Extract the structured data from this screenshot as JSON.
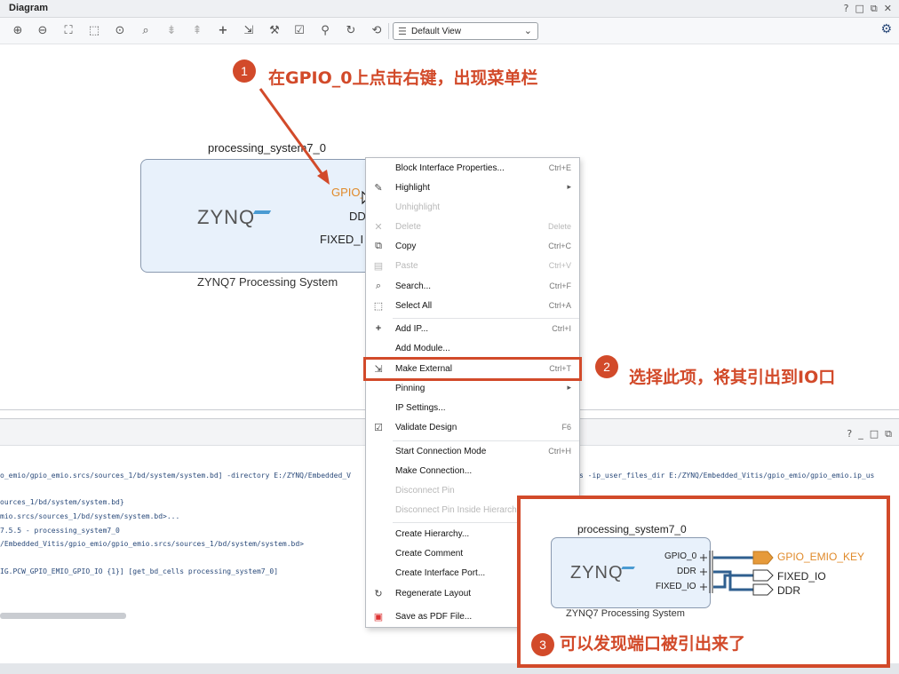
{
  "diagram": {
    "title": "Diagram",
    "window_controls": [
      "?",
      "□",
      "⧉",
      "✕"
    ],
    "view_select": "Default View",
    "toolbar_icons": [
      "zoom-in-icon",
      "zoom-out-icon",
      "zoom-fit-icon",
      "zoom-area-icon",
      "crosshair-icon",
      "search-icon",
      "collapse-icon",
      "expand-icon",
      "add-icon",
      "make-external-icon",
      "wrench-icon",
      "validate-icon",
      "pin-icon",
      "refresh-icon",
      "regenerate-icon"
    ]
  },
  "block": {
    "instance_name": "processing_system7_0",
    "logo": "ZYNQ",
    "caption": "ZYNQ7 Processing System",
    "ports": {
      "gpio": "GPIO_",
      "ddr": "DD",
      "fixed": "FIXED_I"
    }
  },
  "annotations": {
    "step1_num": "1",
    "step1_text": "在GPIO_0上点击右键，出现菜单栏",
    "step2_num": "2",
    "step2_text": "选择此项，将其引出到IO口",
    "step3_num": "3",
    "step3_text": "可以发现端口被引出来了"
  },
  "context_menu": {
    "items": [
      {
        "label": "Block Interface Properties...",
        "shortcut": "Ctrl+E",
        "icon": "",
        "disabled": false
      },
      {
        "label": "Highlight",
        "shortcut": "",
        "icon": "highlight-icon",
        "submenu": true,
        "disabled": false
      },
      {
        "label": "Unhighlight",
        "shortcut": "",
        "icon": "",
        "disabled": true
      },
      {
        "label": "Delete",
        "shortcut": "Delete",
        "icon": "delete-icon",
        "disabled": true
      },
      {
        "label": "Copy",
        "shortcut": "Ctrl+C",
        "icon": "copy-icon",
        "disabled": false
      },
      {
        "label": "Paste",
        "shortcut": "Ctrl+V",
        "icon": "paste-icon",
        "disabled": true
      },
      {
        "label": "Search...",
        "shortcut": "Ctrl+F",
        "icon": "search-icon",
        "disabled": false
      },
      {
        "label": "Select All",
        "shortcut": "Ctrl+A",
        "icon": "select-all-icon",
        "disabled": false
      },
      {
        "label": "Add IP...",
        "shortcut": "Ctrl+I",
        "icon": "add-icon",
        "disabled": false
      },
      {
        "label": "Add Module...",
        "shortcut": "",
        "icon": "",
        "disabled": false
      },
      {
        "label": "Make External",
        "shortcut": "Ctrl+T",
        "icon": "make-external-icon",
        "disabled": false
      },
      {
        "label": "Pinning",
        "shortcut": "",
        "icon": "",
        "submenu": true,
        "disabled": false
      },
      {
        "label": "IP Settings...",
        "shortcut": "",
        "icon": "",
        "disabled": false
      },
      {
        "label": "Validate Design",
        "shortcut": "F6",
        "icon": "validate-icon",
        "disabled": false
      },
      {
        "label": "Start Connection Mode",
        "shortcut": "Ctrl+H",
        "icon": "",
        "disabled": false
      },
      {
        "label": "Make Connection...",
        "shortcut": "",
        "icon": "",
        "disabled": false
      },
      {
        "label": "Disconnect Pin",
        "shortcut": "",
        "icon": "",
        "disabled": true
      },
      {
        "label": "Disconnect Pin Inside Hierarch",
        "shortcut": "",
        "icon": "",
        "disabled": true
      },
      {
        "label": "Create Hierarchy...",
        "shortcut": "",
        "icon": "",
        "disabled": false
      },
      {
        "label": "Create Comment",
        "shortcut": "",
        "icon": "",
        "disabled": false
      },
      {
        "label": "Create Interface Port...",
        "shortcut": "",
        "icon": "",
        "disabled": false
      },
      {
        "label": "Regenerate Layout",
        "shortcut": "",
        "icon": "regenerate-icon",
        "disabled": false
      },
      {
        "label": "Save as PDF File...",
        "shortcut": "",
        "icon": "pdf-icon",
        "disabled": false
      }
    ]
  },
  "console": {
    "window_controls": [
      "?",
      "_",
      "□",
      "⧉"
    ],
    "lines": [
      "o_emio/gpio_emio.srcs/sources_1/bd/system/system.bd] -directory E:/ZYNQ/Embedded_V",
      "ources_1/bd/system/system.bd}",
      "mio.srcs/sources_1/bd/system/system.bd>...",
      "7.5.5 - processing_system7_0",
      "/Embedded_Vitis/gpio_emio/gpio_emio.srcs/sources_1/bd/system/system.bd>",
      "IG.PCW_GPIO_EMIO_GPIO_IO {1}] [get_bd_cells processing_system7_0]"
    ],
    "line_right": "s -ip_user_files_dir E:/ZYNQ/Embedded_Vitis/gpio_emio/gpio_emio.ip_us"
  },
  "result": {
    "instance_name": "processing_system7_0",
    "logo": "ZYNQ",
    "caption": "ZYNQ7 Processing System",
    "ports": [
      "GPIO_0",
      "DDR",
      "FIXED_IO"
    ],
    "external_ports": [
      "GPIO_EMIO_KEY",
      "FIXED_IO",
      "DDR"
    ]
  },
  "colors": {
    "annotation_red": "#d24a2a",
    "gpio_orange": "#e08a2a",
    "block_fill": "#e8f1fb",
    "wire_blue": "#2f5f8f"
  }
}
